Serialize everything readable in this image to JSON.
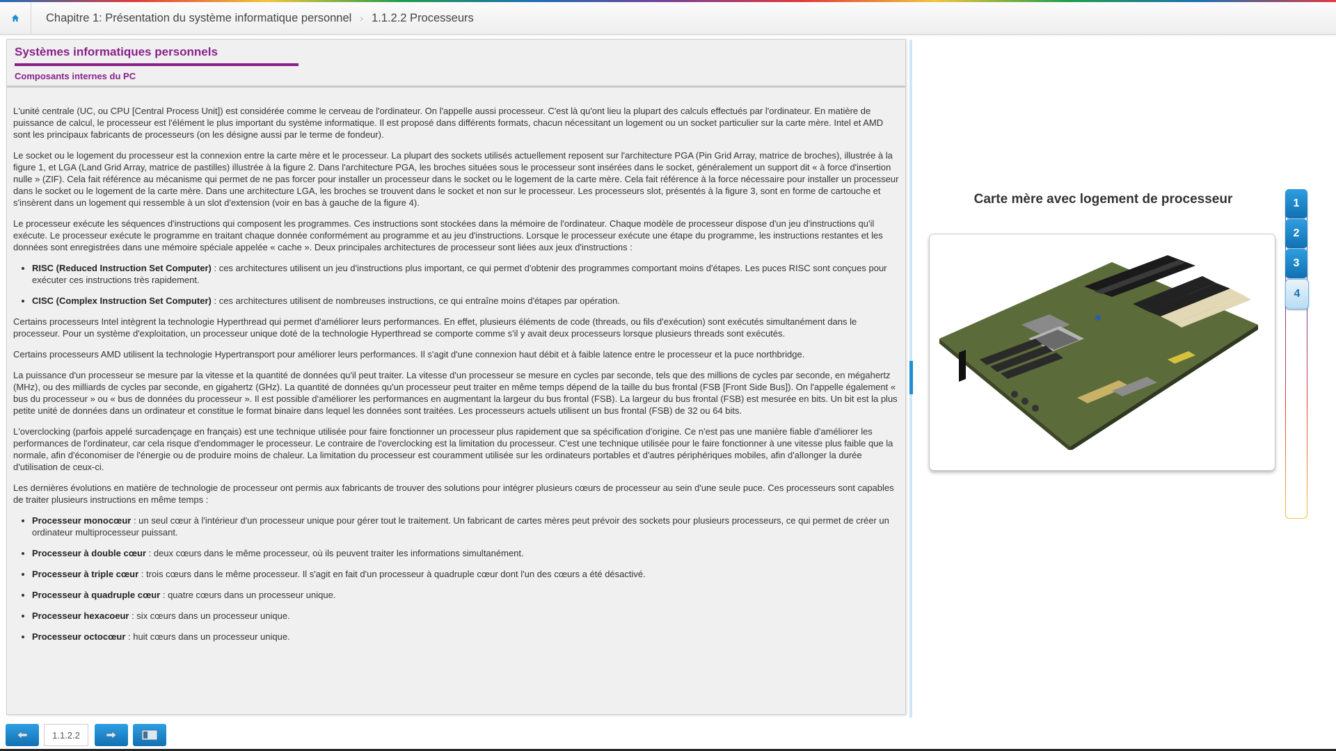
{
  "header": {
    "home_icon": "home-icon",
    "breadcrumb": [
      "Chapitre 1: Présentation du système informatique personnel",
      "1.1.2.2 Processeurs"
    ]
  },
  "content": {
    "module_title": "Systèmes informatiques personnels",
    "section_title": "Composants internes du PC",
    "p1": "L'unité centrale (UC, ou CPU [Central Process Unit]) est considérée comme le cerveau de l'ordinateur. On l'appelle aussi processeur. C'est là qu'ont lieu la plupart des calculs effectués par l'ordinateur. En matière de puissance de calcul, le processeur est l'élément le plus important du système informatique. Il est proposé dans différents formats, chacun nécessitant un logement ou un socket particulier sur la carte mère. Intel et AMD sont les principaux fabricants de processeurs (on les désigne aussi par le terme de fondeur).",
    "p2": "Le socket ou le logement du processeur est la connexion entre la carte mère et le processeur. La plupart des sockets utilisés actuellement reposent sur l'architecture PGA (Pin Grid Array, matrice de broches), illustrée à la figure 1, et LGA (Land Grid Array, matrice de pastilles) illustrée à la figure 2. Dans l'architecture PGA, les broches situées sous le processeur sont insérées dans le socket, généralement un support dit « à force d'insertion nulle » (ZIF). Cela fait référence au mécanisme qui permet de ne pas forcer pour installer un processeur dans le socket ou le logement de la carte mère. Cela fait référence à la force nécessaire pour installer un processeur dans le socket ou le logement de la carte mère. Dans une architecture LGA, les broches se trouvent dans le socket et non sur le processeur. Les processeurs slot, présentés à la figure 3, sont en forme de cartouche et s'insèrent dans un logement qui ressemble à un slot d'extension (voir en bas à gauche de la figure 4).",
    "p3": "Le processeur exécute les séquences d'instructions qui composent les programmes. Ces instructions sont stockées dans la mémoire de l'ordinateur. Chaque modèle de processeur dispose d'un jeu d'instructions qu'il exécute. Le processeur exécute le programme en traitant chaque donnée conformément au programme et au jeu d'instructions. Lorsque le processeur exécute une étape du programme, les instructions restantes et les données sont enregistrées dans une mémoire spéciale appelée « cache ». Deux principales architectures de processeur sont liées aux jeux d'instructions :",
    "list1": [
      {
        "term": "RISC (Reduced Instruction Set Computer)",
        "desc": " : ces architectures utilisent un jeu d'instructions plus important, ce qui permet d'obtenir des programmes comportant moins d'étapes. Les puces RISC sont conçues pour exécuter ces instructions très rapidement."
      },
      {
        "term": "CISC (Complex Instruction Set Computer)",
        "desc": " : ces architectures utilisent de nombreuses instructions, ce qui entraîne moins d'étapes par opération."
      }
    ],
    "p4": "Certains processeurs Intel intègrent la technologie Hyperthread qui permet d'améliorer leurs performances. En effet, plusieurs éléments de code (threads, ou fils d'exécution) sont exécutés simultanément dans le processeur. Pour un système d'exploitation, un processeur unique doté de la technologie Hyperthread se comporte comme s'il y avait deux processeurs lorsque plusieurs threads sont exécutés.",
    "p5": "Certains processeurs AMD utilisent la technologie Hypertransport pour améliorer leurs performances. Il s'agit d'une connexion haut débit et à faible latence entre le processeur et la puce northbridge.",
    "p6": "La puissance d'un processeur se mesure par la vitesse et la quantité de données qu'il peut traiter. La vitesse d'un processeur se mesure en cycles par seconde, tels que des millions de cycles par seconde, en mégahertz (MHz), ou des milliards de cycles par seconde, en gigahertz (GHz). La quantité de données qu'un processeur peut traiter en même temps dépend de la taille du bus frontal (FSB [Front Side Bus]). On l'appelle également « bus du processeur » ou « bus de données du processeur ». Il est possible d'améliorer les performances en augmentant la largeur du bus frontal (FSB). La largeur du bus frontal (FSB) est mesurée en bits. Un bit est la plus petite unité de données dans un ordinateur et constitue le format binaire dans lequel les données sont traitées. Les processeurs actuels utilisent un bus frontal (FSB) de 32 ou 64 bits.",
    "p7": "L'overclocking (parfois appelé surcadençage en français) est une technique utilisée pour faire fonctionner un processeur plus rapidement que sa spécification d'origine. Ce n'est pas une manière fiable d'améliorer les performances de l'ordinateur, car cela risque d'endommager le processeur. Le contraire de l'overclocking est la limitation du processeur. C'est une technique utilisée pour le faire fonctionner à une vitesse plus faible que la normale, afin d'économiser de l'énergie ou de produire moins de chaleur. La limitation du processeur est couramment utilisée sur les ordinateurs portables et d'autres périphériques mobiles, afin d'allonger la durée d'utilisation de ceux-ci.",
    "p8": "Les dernières évolutions en matière de technologie de processeur ont permis aux fabricants de trouver des solutions pour intégrer plusieurs cœurs de processeur au sein d'une seule puce. Ces processeurs sont capables de traiter plusieurs instructions en même temps :",
    "list2": [
      {
        "term": "Processeur monocœur",
        "desc": " : un seul cœur à l'intérieur d'un processeur unique pour gérer tout le traitement. Un fabricant de cartes mères peut prévoir des sockets pour plusieurs processeurs, ce qui permet de créer un ordinateur multiprocesseur puissant."
      },
      {
        "term": "Processeur à double cœur",
        "desc": " : deux cœurs dans le même processeur, où ils peuvent traiter les informations simultanément."
      },
      {
        "term": "Processeur à triple cœur",
        "desc": " : trois cœurs dans le même processeur. Il s'agit en fait d'un processeur à quadruple cœur dont l'un des cœurs a été désactivé."
      },
      {
        "term": "Processeur à quadruple cœur",
        "desc": " : quatre cœurs dans un processeur unique."
      },
      {
        "term": "Processeur hexacoeur",
        "desc": " : six cœurs dans un processeur unique."
      },
      {
        "term": "Processeur octocœur",
        "desc": " : huit cœurs dans un processeur unique."
      }
    ]
  },
  "figure": {
    "title": "Carte mère avec logement de processeur",
    "image": "motherboard-image"
  },
  "tabs": [
    "1",
    "2",
    "3",
    "4"
  ],
  "active_tab": "4",
  "footer": {
    "page_number": "1.1.2.2",
    "prev_icon": "arrow-left-icon",
    "next_icon": "arrow-right-icon",
    "toc_icon": "toc-icon"
  },
  "colors": {
    "accent": "#8a1f8a",
    "button_blue": "#1d8fd1"
  }
}
